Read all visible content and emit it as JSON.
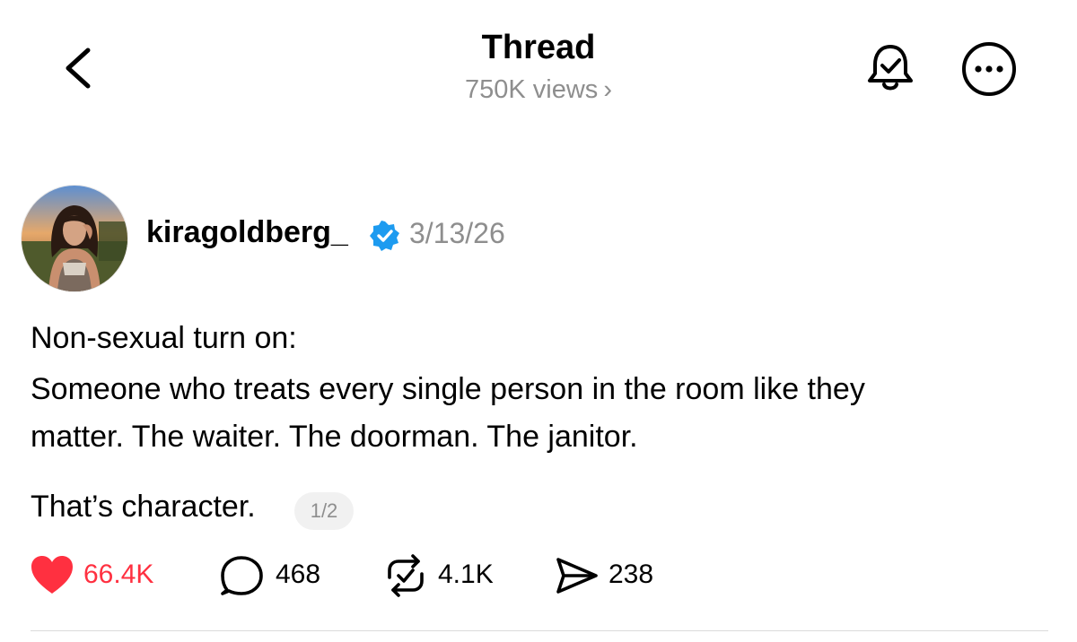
{
  "header": {
    "title": "Thread",
    "views": "750K views",
    "back_icon": "chevron-left-icon",
    "views_icon": "chevron-right-icon",
    "notify_icon": "bell-check-icon",
    "more_icon": "more-circle-icon"
  },
  "post": {
    "username": "kiragoldberg_",
    "verified": true,
    "date": "3/13/26",
    "lines": [
      "Non-sexual turn on:",
      "Someone who treats every single person in the room like they",
      "matter. The waiter. The doorman. The janitor.",
      "That’s character."
    ],
    "page_indicator": "1/2"
  },
  "actions": {
    "likes": "66.4K",
    "comments": "468",
    "reposts": "4.1K",
    "shares": "238",
    "liked": true
  },
  "colors": {
    "like": "#ff3040",
    "verified": "#1d9bf0",
    "muted": "#8e8e8e",
    "divider": "#dbdbdb"
  }
}
